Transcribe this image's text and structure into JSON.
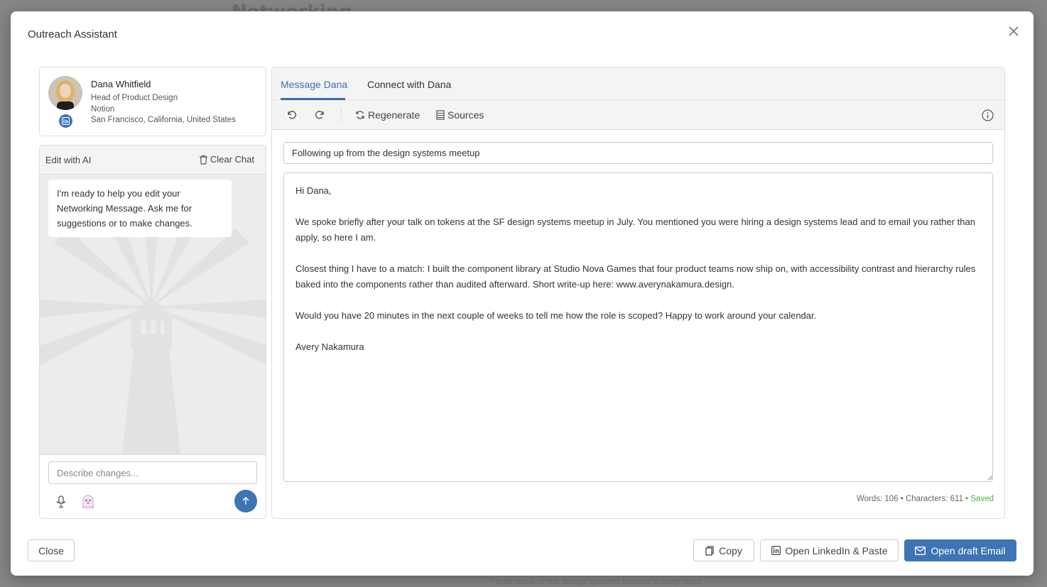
{
  "background": {
    "title": "Networking",
    "bottom_text": "• Built some of the design systems content in early days"
  },
  "modal": {
    "title": "Outreach Assistant"
  },
  "profile": {
    "name": "Dana Whitfield",
    "role": "Head of Product Design",
    "company": "Notion",
    "location": "San Francisco, California, United States"
  },
  "chat": {
    "header": "Edit with AI",
    "clear_label": "Clear Chat",
    "message": "I'm ready to help you edit your Networking Message. Ask me for suggestions or to make changes.",
    "input_placeholder": "Describe changes..."
  },
  "editor": {
    "tabs": [
      "Message Dana",
      "Connect with Dana"
    ],
    "toolbar": {
      "regenerate": "Regenerate",
      "sources": "Sources"
    },
    "subject": "Following up from the design systems meetup",
    "body": "Hi Dana,\n\nWe spoke briefly after your talk on tokens at the SF design systems meetup in July. You mentioned you were hiring a design systems lead and to email you rather than apply, so here I am.\n\nClosest thing I have to a match: I built the component library at Studio Nova Games that four product teams now ship on, with accessibility contrast and hierarchy rules baked into the components rather than audited afterward. Short write-up here: www.averynakamura.design.\n\nWould you have 20 minutes in the next couple of weeks to tell me how the role is scoped? Happy to work around your calendar.\n\nAvery Nakamura",
    "stats": "Words: 106 • Characters: 611",
    "saved": "• Saved"
  },
  "footer": {
    "close": "Close",
    "copy": "Copy",
    "linkedin": "Open LinkedIn & Paste",
    "email": "Open draft Email"
  },
  "colors": {
    "accent": "#3e74b5",
    "saved": "#4caf50"
  }
}
